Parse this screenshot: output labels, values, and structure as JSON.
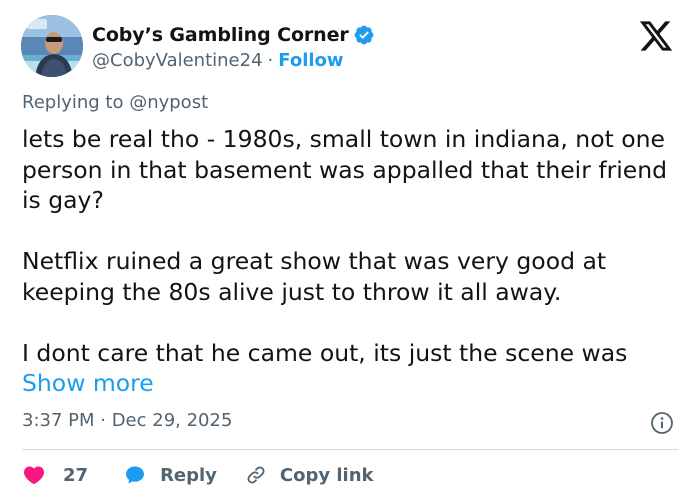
{
  "author": {
    "display_name": "Coby’s Gambling Corner",
    "handle": "@CobyValentine24",
    "separator": "·",
    "follow_label": "Follow"
  },
  "reply_to": "Replying to @nypost",
  "tweet": {
    "paragraphs": [
      "lets be real tho - 1980s, small town in indiana, not one person in that basement was appalled that their friend is gay?",
      "Netflix ruined a great show that was very good at keeping the 80s alive just to throw it all away.",
      "I dont care that he came out, its just the scene was "
    ],
    "show_more_label": "Show more"
  },
  "timestamp": "3:37 PM · Dec 29, 2025",
  "actions": {
    "like_count": "27",
    "reply_label": "Reply",
    "copy_link_label": "Copy link"
  },
  "colors": {
    "accent": "#1d9bf0",
    "like": "#f91880",
    "muted": "#536471",
    "text": "#0f1419"
  }
}
